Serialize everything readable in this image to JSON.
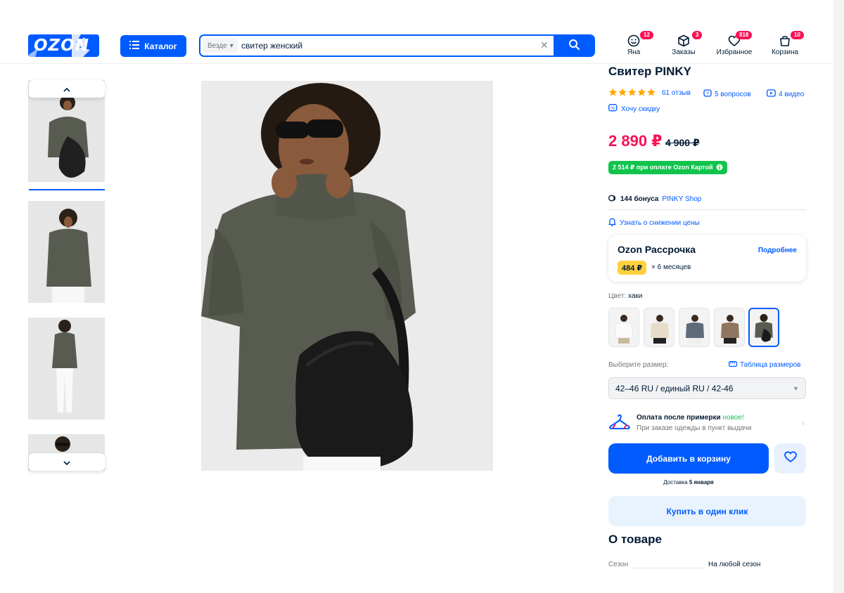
{
  "header": {
    "logo": "OZON",
    "catalog_label": "Каталог",
    "search": {
      "scope": "Везде",
      "query": "свитер женский"
    },
    "nav": [
      {
        "label": "Яна",
        "badge": "12"
      },
      {
        "label": "Заказы",
        "badge": "3"
      },
      {
        "label": "Избранное",
        "badge": "818"
      },
      {
        "label": "Корзина",
        "badge": "10"
      }
    ]
  },
  "product": {
    "title": "Свитер PINKY",
    "rating_stars": 5,
    "reviews": "61 отзыв",
    "questions": "5 вопросов",
    "videos": "4 видео",
    "want_discount": "Хочу скидку",
    "price": "2 890 ₽",
    "old_price": "4 900 ₽",
    "card_price": "2 514 ₽ при оплате Ozon Картой",
    "bonus_count": "144 бонуса",
    "bonus_shop": "PINKY Shop",
    "price_drop": "Узнать о снижении цены",
    "installment": {
      "title": "Ozon Рассрочка",
      "more": "Подробнее",
      "monthly": "484 ₽",
      "months": "× 6 месяцев"
    },
    "color_label": "Цвет:",
    "color_value": "хаки",
    "size_label": "Выберите размер:",
    "size_table": "Таблица размеров",
    "size_selected": "42–46 RU / единый RU / 42-46",
    "tryon_title": "Оплата после примерки",
    "tryon_new": "новое!",
    "tryon_sub": "При заказе одежды в пункт выдачи",
    "add_to_cart": "Добавить в корзину",
    "delivery_prefix": "Доставка",
    "delivery_date": "5 января",
    "buy_one_click": "Купить в один клик",
    "about_title": "О товаре",
    "attr_season_label": "Сезон",
    "attr_season_value": "На любой сезон"
  },
  "colors": {
    "primary": "#005bff",
    "price": "#f91155",
    "green": "#10c44c",
    "sweater": "#585c50"
  }
}
